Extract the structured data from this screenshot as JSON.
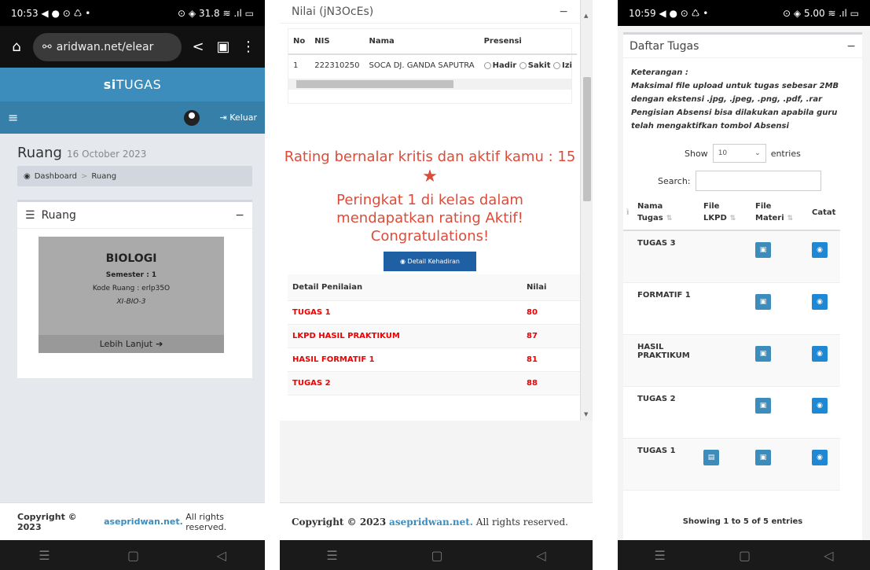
{
  "screens": {
    "left": {
      "status_time": "10:53",
      "status_icons": "◀ ● ⊙ ♺ •",
      "status_right": "⊙ ◈ 31.8 ≋ .ıl ▭",
      "url": "aridwan.net/elear",
      "brand_bold": "si",
      "brand_rest": "TUGAS",
      "logout_label": "Keluar",
      "page_title": "Ruang",
      "page_date": "16 October 2023",
      "breadcrumb": [
        "Dashboard",
        "Ruang"
      ],
      "box_title": "Ruang",
      "course": {
        "title": "BIOLOGI",
        "semester": "Semester : 1",
        "kode": "Kode Ruang : erlp35O",
        "class": "XI-BIO-3",
        "more": "Lebih Lanjut"
      },
      "footer_prefix": "Copyright © 2023",
      "footer_link": "asepridwan.net.",
      "footer_suffix": "All rights reserved."
    },
    "middle": {
      "box_title": "Nilai (jN3OcEs)",
      "table_headers": [
        "No",
        "NIS",
        "Nama",
        "Presensi"
      ],
      "row": {
        "no": "1",
        "nis": "222310250",
        "nama": "SOCA DJ. GANDA SAPUTRA"
      },
      "presensi_options": [
        "Hadir",
        "Sakit",
        "Izi"
      ],
      "rating_text": "Rating bernalar kritis dan aktif kamu : 15",
      "peringkat_text": "Peringkat 1 di kelas dalam mendapatkan rating Aktif!",
      "congrats": "Congratulations!",
      "detail_button": "Detail Kehadiran",
      "penilaian_headers": [
        "Detail Penilaian",
        "Nilai"
      ],
      "penilaian": [
        {
          "name": "TUGAS 1",
          "nilai": "80"
        },
        {
          "name": "LKPD HASIL PRAKTIKUM",
          "nilai": "87"
        },
        {
          "name": "HASIL FORMATIF 1",
          "nilai": "81"
        },
        {
          "name": "TUGAS 2",
          "nilai": "88"
        }
      ],
      "footer_prefix": "Copyright © 2023",
      "footer_link": "asepridwan.net.",
      "footer_suffix": "All rights reserved."
    },
    "right": {
      "status_time": "10:59",
      "status_icons": "◀ ● ⊙ ♺ •",
      "status_right": "⊙ ◈ 5.00 ≋ .ıl ▭",
      "box_title": "Daftar Tugas",
      "ket_title": "Keterangan :",
      "ket_lines": [
        "Maksimal file upload untuk tugas sebesar 2MB",
        "dengan ekstensi .jpg, .jpeg, .png, .pdf, .rar",
        "Pengisian Absensi bisa dilakukan apabila guru",
        "telah mengaktifkan tombol Absensi"
      ],
      "show_label": "Show",
      "show_value": "10",
      "entries_label": "entries",
      "search_label": "Search:",
      "headers": [
        "Nama Tugas",
        "File LKPD",
        "File Materi",
        "Catat"
      ],
      "rows": [
        {
          "name": "TUGAS 3",
          "lkpd": false
        },
        {
          "name": "FORMATIF 1",
          "lkpd": false
        },
        {
          "name": "HASIL PRAKTIKUM",
          "lkpd": false
        },
        {
          "name": "TUGAS 2",
          "lkpd": false
        },
        {
          "name": "TUGAS 1",
          "lkpd": true
        }
      ],
      "showing_text": "Showing 1 to 5 of 5 entries"
    }
  },
  "colors": {
    "primary": "#3c8dbc",
    "dark_primary": "#367fa9",
    "alert": "#dd4b39",
    "grade": "#ee0000"
  }
}
